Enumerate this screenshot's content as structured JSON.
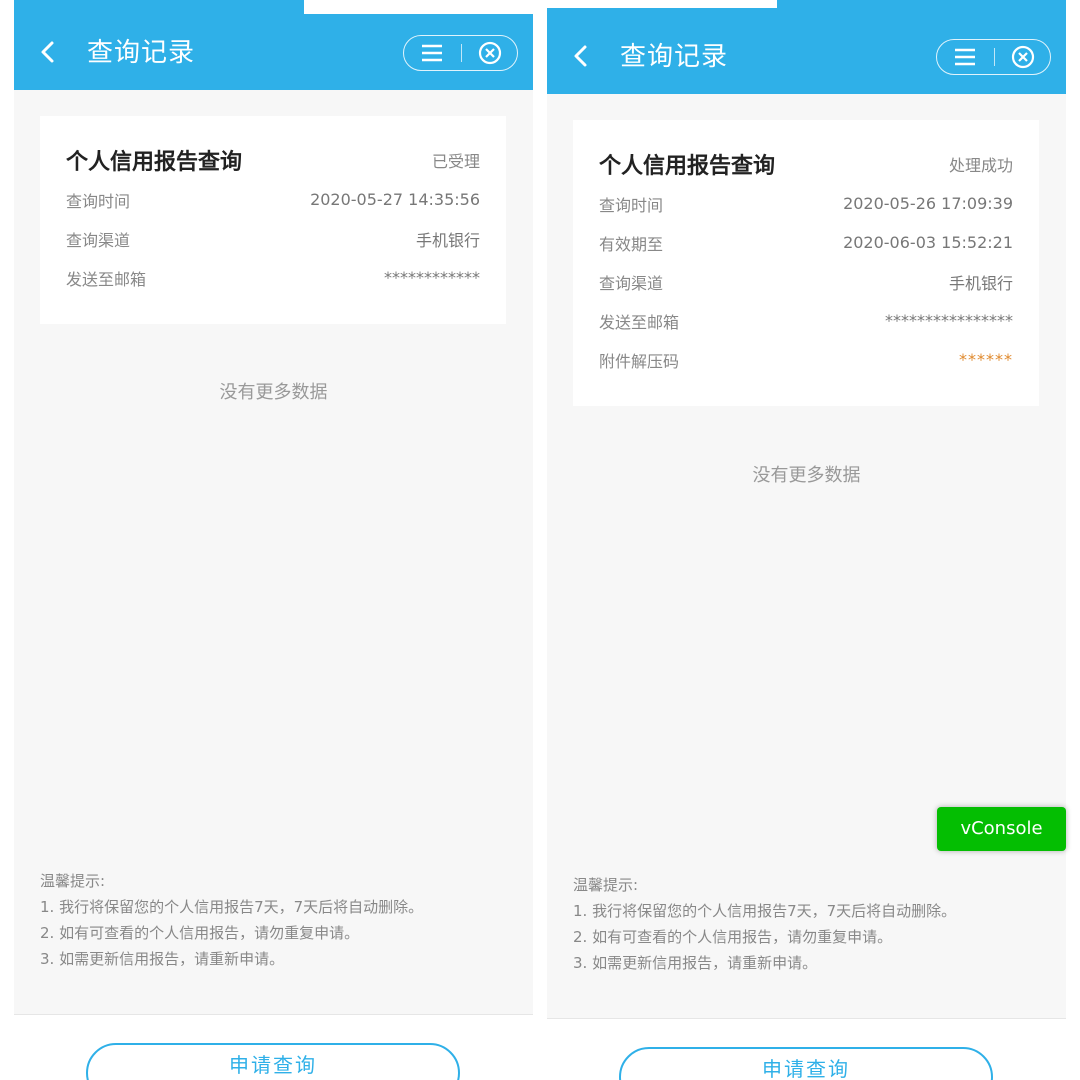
{
  "colors": {
    "header": "#2fb0e8",
    "accent": "#2fb0e8",
    "vconsole": "#04be02",
    "password": "#e08a2e"
  },
  "icons": {
    "back": "chevron-left-icon",
    "menu": "menu-icon",
    "close": "close-circle-icon"
  },
  "left": {
    "title": "查询记录",
    "card": {
      "title": "个人信用报告查询",
      "status": "已受理",
      "rows": [
        {
          "label": "查询时间",
          "value": "2020-05-27 14:35:56"
        },
        {
          "label": "查询渠道",
          "value": "手机银行"
        },
        {
          "label": "发送至邮箱",
          "value": "************"
        }
      ]
    },
    "no_more": "没有更多数据",
    "tips": {
      "heading": "温馨提示:",
      "items": [
        "1. 我行将保留您的个人信用报告7天，7天后将自动删除。",
        "2. 如有可查看的个人信用报告，请勿重复申请。",
        "3. 如需更新信用报告，请重新申请。"
      ]
    },
    "apply_label": "申请查询"
  },
  "right": {
    "title": "查询记录",
    "card": {
      "title": "个人信用报告查询",
      "status": "处理成功",
      "rows": [
        {
          "label": "查询时间",
          "value": "2020-05-26 17:09:39"
        },
        {
          "label": "有效期至",
          "value": "2020-06-03 15:52:21"
        },
        {
          "label": "查询渠道",
          "value": "手机银行"
        },
        {
          "label": "发送至邮箱",
          "value": "****************"
        },
        {
          "label": "附件解压码",
          "value": "******"
        }
      ]
    },
    "no_more": "没有更多数据",
    "tips": {
      "heading": "温馨提示:",
      "items": [
        "1. 我行将保留您的个人信用报告7天，7天后将自动删除。",
        "2. 如有可查看的个人信用报告，请勿重复申请。",
        "3. 如需更新信用报告，请重新申请。"
      ]
    },
    "apply_label": "申请查询"
  },
  "vconsole_label": "vConsole"
}
